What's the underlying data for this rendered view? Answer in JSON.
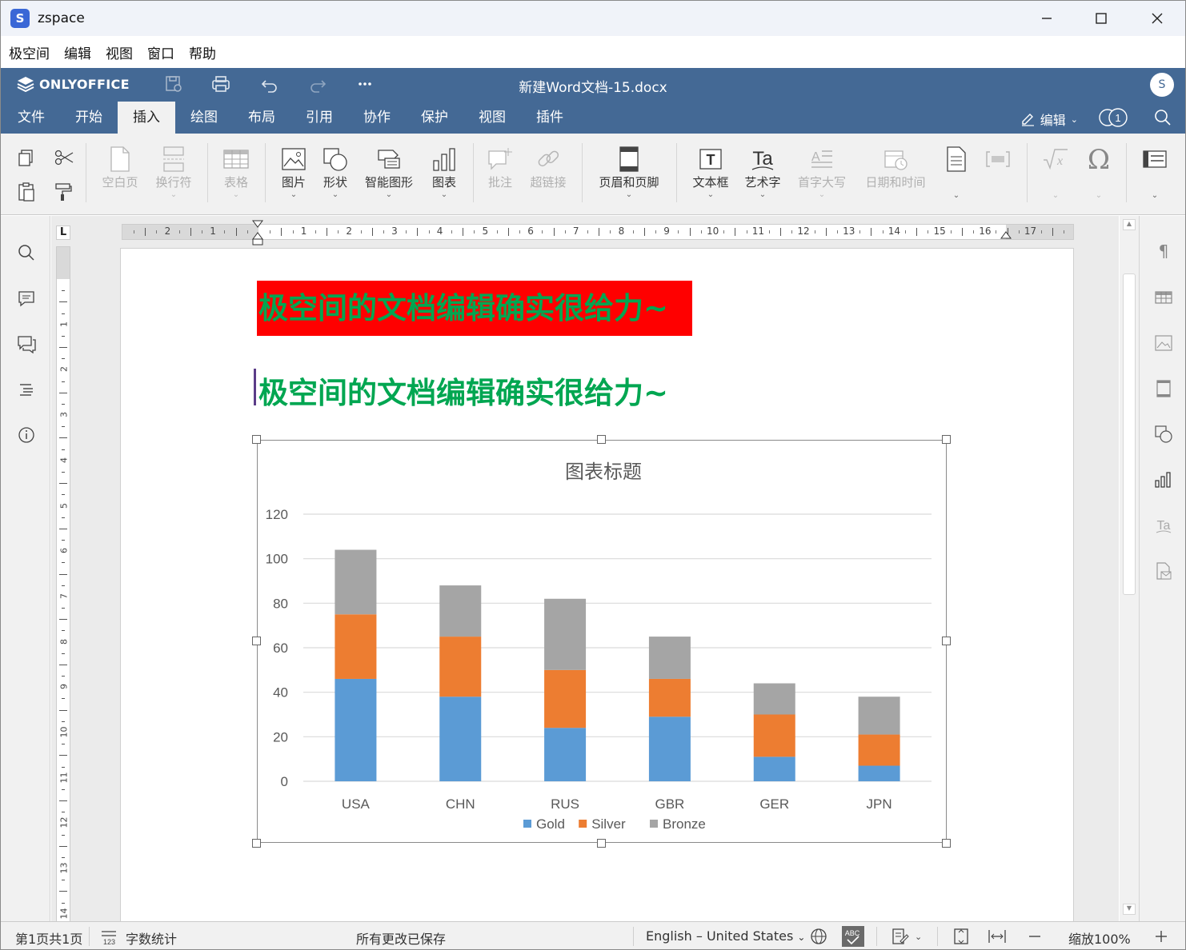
{
  "window": {
    "title": "zspace",
    "logo_letter": "S"
  },
  "menubar": [
    "极空间",
    "编辑",
    "视图",
    "窗口",
    "帮助"
  ],
  "header": {
    "brand": "ONLYOFFICE",
    "doc_title": "新建Word文档-15.docx",
    "user_initial": "S",
    "edit_mode": "编辑",
    "coeditors": "1"
  },
  "tabs": [
    "文件",
    "开始",
    "插入",
    "绘图",
    "布局",
    "引用",
    "协作",
    "保护",
    "视图",
    "插件"
  ],
  "active_tab": "插入",
  "toolbar": {
    "blank_page": "空白页",
    "line_break": "换行符",
    "table": "表格",
    "image": "图片",
    "shape": "形状",
    "smartart": "智能图形",
    "chart": "图表",
    "comment": "批注",
    "hyperlink": "超链接",
    "header_footer": "页眉和页脚",
    "textbox": "文本框",
    "textart": "艺术字",
    "dropcap": "首字大写",
    "datetime": "日期和时间"
  },
  "ruler": {
    "h_labels": [
      "2",
      "1",
      "1",
      "2",
      "3",
      "4",
      "5",
      "6",
      "7",
      "8",
      "9",
      "10",
      "11",
      "12",
      "13",
      "14",
      "15",
      "16",
      "17"
    ],
    "v_labels": [
      "1",
      "2",
      "3",
      "4",
      "5",
      "6",
      "7",
      "8",
      "9",
      "10",
      "11",
      "12",
      "13",
      "14"
    ],
    "corner": "L"
  },
  "document": {
    "heading1": "极空间的文档编辑确实很给力~",
    "heading2": "极空间的文档编辑确实很给力~",
    "heading1_bg": "#ff0000",
    "heading_color": "#00a651"
  },
  "chart_data": {
    "type": "bar",
    "stacked": true,
    "title": "图表标题",
    "categories": [
      "USA",
      "CHN",
      "RUS",
      "GBR",
      "GER",
      "JPN"
    ],
    "series": [
      {
        "name": "Gold",
        "color": "#5b9bd5",
        "values": [
          46,
          38,
          24,
          29,
          11,
          7
        ]
      },
      {
        "name": "Silver",
        "color": "#ed7d31",
        "values": [
          29,
          27,
          26,
          17,
          19,
          14
        ]
      },
      {
        "name": "Bronze",
        "color": "#a5a5a5",
        "values": [
          29,
          23,
          32,
          19,
          14,
          17
        ]
      }
    ],
    "ylim": [
      0,
      120
    ],
    "yticks": [
      0,
      20,
      40,
      60,
      80,
      100,
      120
    ],
    "grid": true,
    "legend": "bottom"
  },
  "status": {
    "page": "第1页共1页",
    "word_count": "字数统计",
    "saved": "所有更改已保存",
    "language": "English – United States",
    "zoom": "缩放100%"
  }
}
